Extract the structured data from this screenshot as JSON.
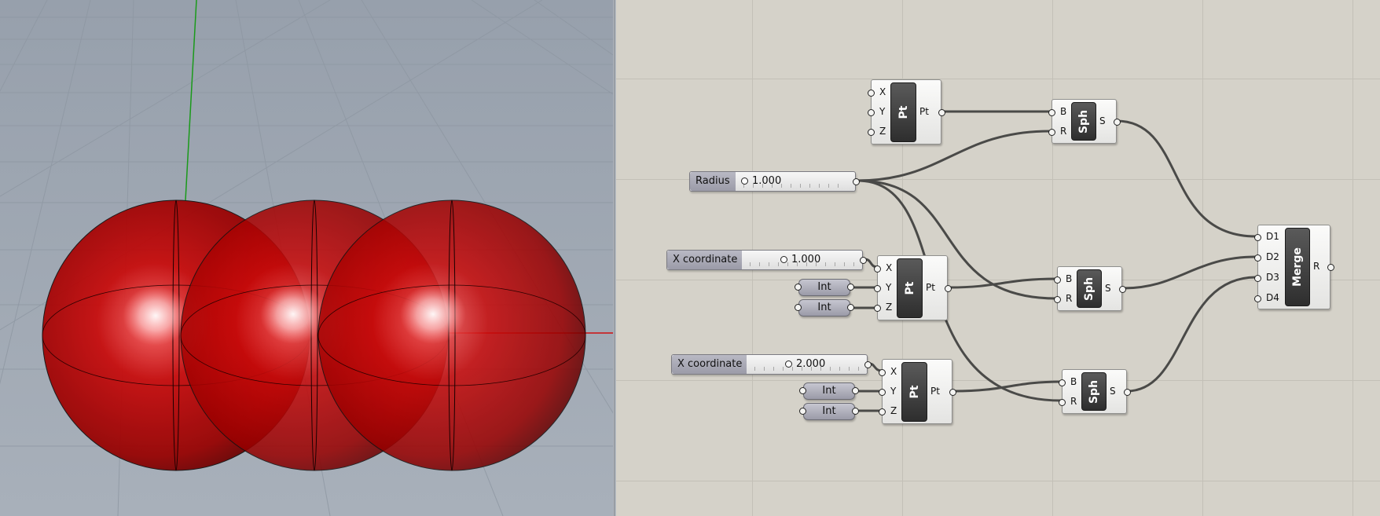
{
  "colors": {
    "viewport_background": "#a4adb8",
    "canvas_background": "#d5d2c9",
    "sphere": "#b80000",
    "wire": "#4a4a48",
    "axis_x": "#d01010",
    "axis_y": "#1a9a1a"
  },
  "sliders": [
    {
      "label": "Radius",
      "value": "1.000"
    },
    {
      "label": "X coordinate",
      "value": "1.000"
    },
    {
      "label": "X coordinate",
      "value": "2.000"
    }
  ],
  "int_panels": [
    "Int",
    "Int",
    "Int",
    "Int"
  ],
  "point_component": {
    "name": "Pt",
    "inputs": [
      "X",
      "Y",
      "Z"
    ],
    "output": "Pt"
  },
  "sphere_component": {
    "name": "Sph",
    "inputs": [
      "B",
      "R"
    ],
    "output": "S"
  },
  "merge_component": {
    "name": "Merge",
    "inputs": [
      "D1",
      "D2",
      "D3",
      "D4"
    ],
    "output": "R"
  }
}
